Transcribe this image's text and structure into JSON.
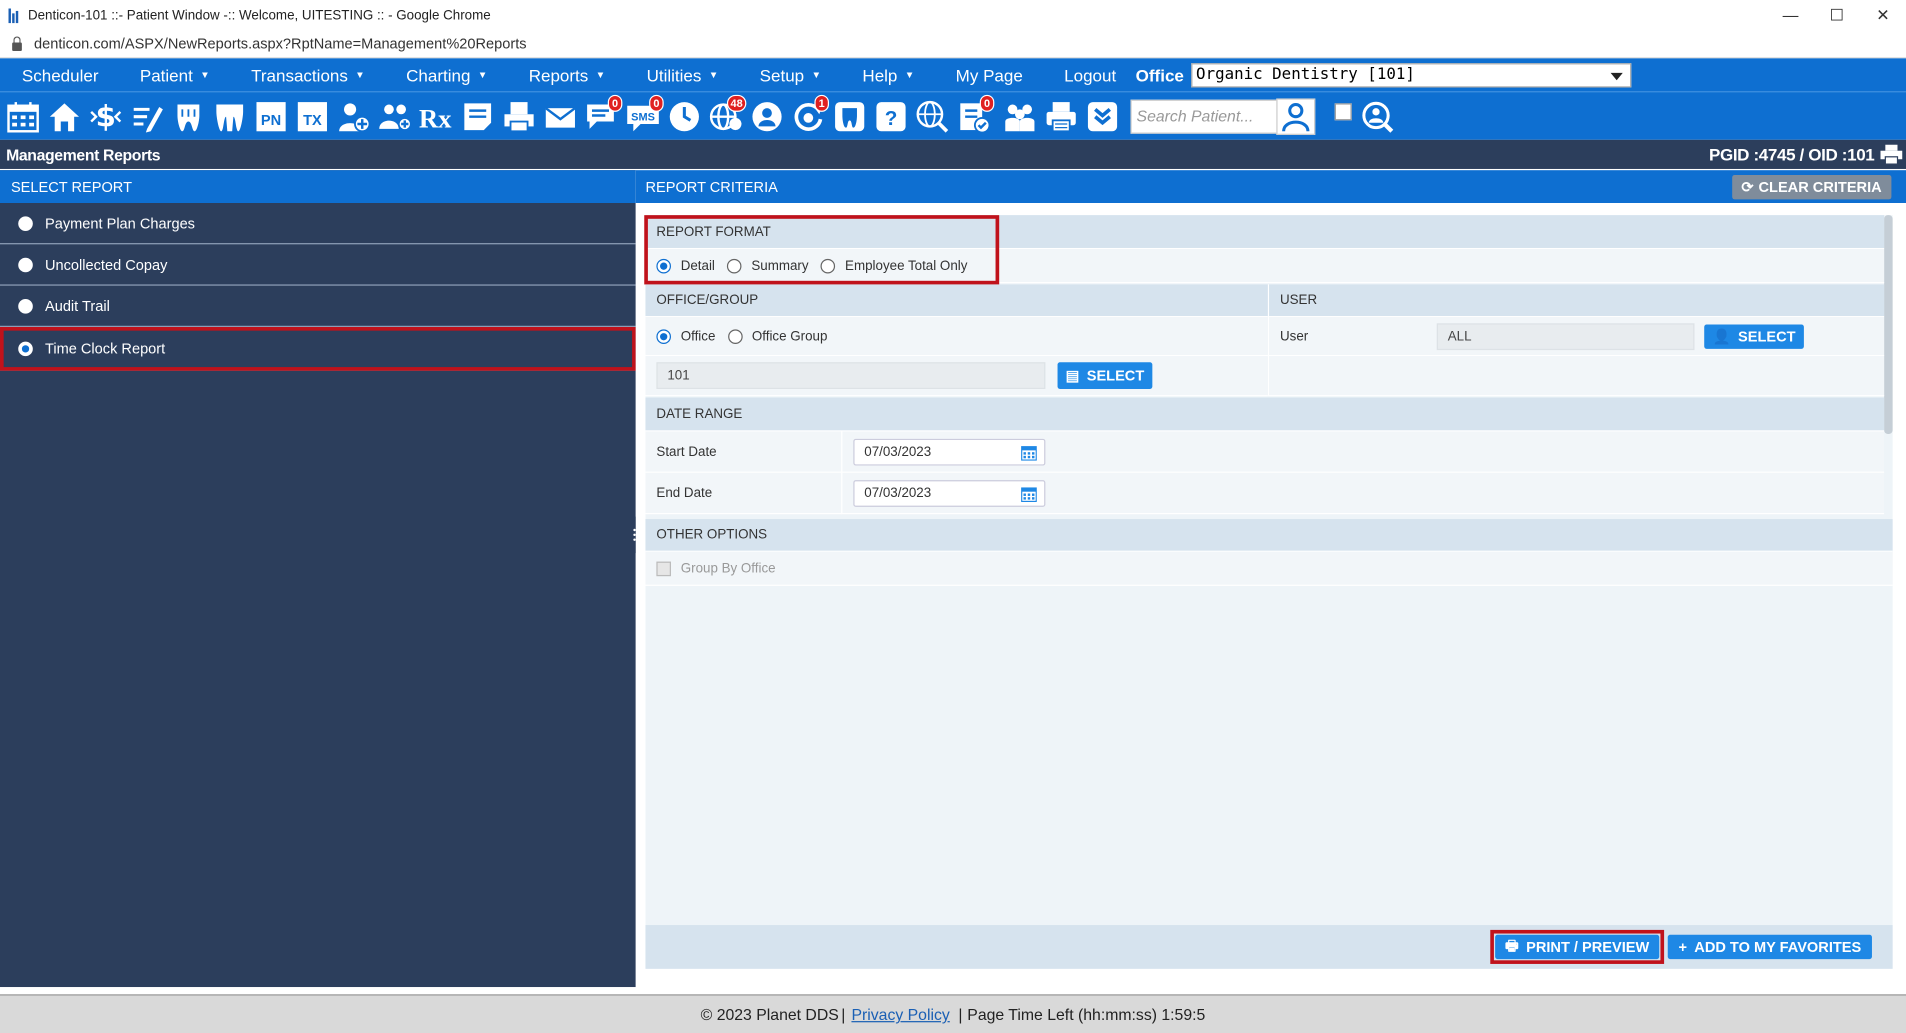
{
  "window": {
    "title": "Denticon-101 ::- Patient Window -:: Welcome, UITESTING :: - Google Chrome",
    "url": "denticon.com/ASPX/NewReports.aspx?RptName=Management%20Reports",
    "controls": [
      "—",
      "☐",
      "✕"
    ]
  },
  "menu": {
    "items": [
      {
        "label": "Scheduler",
        "caret": false
      },
      {
        "label": "Patient",
        "caret": true
      },
      {
        "label": "Transactions",
        "caret": true
      },
      {
        "label": "Charting",
        "caret": true
      },
      {
        "label": "Reports",
        "caret": true
      },
      {
        "label": "Utilities",
        "caret": true
      },
      {
        "label": "Setup",
        "caret": true
      },
      {
        "label": "Help",
        "caret": true
      },
      {
        "label": "My Page",
        "caret": false
      },
      {
        "label": "Logout",
        "caret": false
      }
    ],
    "office_label": "Office",
    "office_value": "Organic Dentistry [101]"
  },
  "toolbar": {
    "icons": [
      "calendar-icon",
      "home-icon",
      "dollar-icon",
      "edit-notes-icon",
      "tooth-icon",
      "teeth-icon",
      "pn-icon",
      "tx-icon",
      "add-patient-icon",
      "family-icon",
      "rx-icon",
      "notes-icon",
      "printer-form-icon",
      "mail-icon",
      "message-icon",
      "sms-icon",
      "clock-icon",
      "globe-icon",
      "support-icon",
      "refresh-alert-icon",
      "tooth-outline-icon",
      "help-icon",
      "globe-search-icon",
      "checklist-icon",
      "people-icon",
      "print-icon",
      "chevron-down-icon"
    ],
    "pn_text": "PN",
    "tx_text": "TX",
    "rx_text": "Rx",
    "sms_text": "SMS",
    "badges": {
      "message": "0",
      "sms": "0",
      "globe": "48",
      "refresh": "1",
      "checklist": "0"
    },
    "search_placeholder": "Search Patient..."
  },
  "page": {
    "title": "Management Reports",
    "ids": "PGID :4745  /  OID :101"
  },
  "select_report": {
    "header": "SELECT REPORT",
    "items": [
      {
        "label": "Payment Plan Charges",
        "selected": false
      },
      {
        "label": "Uncollected Copay",
        "selected": false
      },
      {
        "label": "Audit Trail",
        "selected": false
      },
      {
        "label": "Time Clock Report",
        "selected": true
      }
    ]
  },
  "criteria": {
    "header": "REPORT CRITERIA",
    "clear_label": "CLEAR CRITERIA",
    "report_format": {
      "label": "REPORT FORMAT",
      "options": [
        "Detail",
        "Summary",
        "Employee Total Only"
      ],
      "selected": "Detail"
    },
    "office_group": {
      "label": "OFFICE/GROUP",
      "options": [
        "Office",
        "Office Group"
      ],
      "selected": "Office",
      "value": "101",
      "select_label": "SELECT"
    },
    "user": {
      "label": "USER",
      "field_label": "User",
      "value": "ALL",
      "select_label": "SELECT"
    },
    "date_range": {
      "label": "DATE RANGE",
      "start_label": "Start Date",
      "start_value": "07/03/2023",
      "end_label": "End Date",
      "end_value": "07/03/2023"
    },
    "other_options": {
      "label": "OTHER OPTIONS",
      "group_by_office": "Group By Office",
      "group_by_office_checked": false
    },
    "print_label": "PRINT / PREVIEW",
    "favorites_label": "ADD TO MY FAVORITES"
  },
  "footer": {
    "copyright": "© 2023 Planet DDS",
    "privacy": "Privacy Policy",
    "time_left": "Page Time Left (hh:mm:ss) 1:59:5"
  },
  "colors": {
    "brand_blue": "#0e6fd1",
    "panel_navy": "#2c3e5c",
    "highlight_red": "#c0121b",
    "button_blue": "#1e88e5"
  }
}
